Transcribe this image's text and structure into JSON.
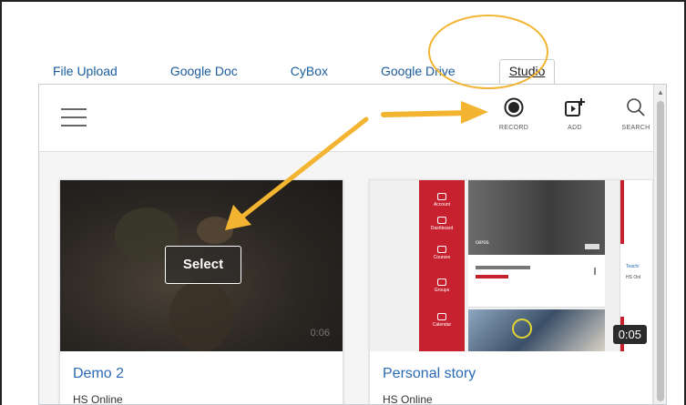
{
  "tabs": [
    {
      "label": "File Upload",
      "active": false
    },
    {
      "label": "Google Doc",
      "active": false
    },
    {
      "label": "CyBox",
      "active": false
    },
    {
      "label": "Google Drive",
      "active": false
    },
    {
      "label": "Studio",
      "active": true
    }
  ],
  "toolbar": {
    "record_label": "RECORD",
    "add_label": "ADD",
    "search_label": "SEARCH"
  },
  "cards": [
    {
      "title": "Demo 2",
      "owner": "HS Online",
      "select_label": "Select",
      "duration": "0:06"
    },
    {
      "title": "Personal story",
      "owner": "HS Online",
      "duration": "0:05"
    }
  ],
  "collage": {
    "sidebar_items": [
      "Account",
      "Dashboard",
      "Courses",
      "Groups",
      "Calendar"
    ],
    "photo_tag": "ceros",
    "side_text_1": "Teachi",
    "side_text_2": "HS Onl"
  },
  "colors": {
    "link_blue": "#1a5c9e",
    "annotation_orange": "#f2b431",
    "canvas_red": "#c7212f"
  },
  "icons": [
    "hamburger-icon",
    "record-icon",
    "add-media-icon",
    "search-icon"
  ]
}
